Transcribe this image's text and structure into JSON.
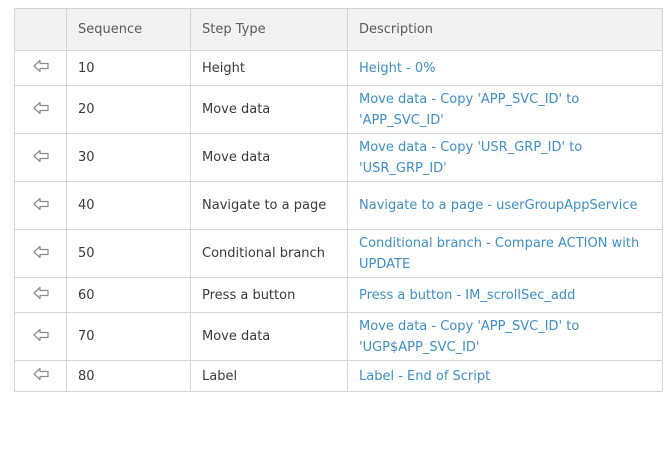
{
  "table": {
    "headers": [
      "",
      "Sequence",
      "Step Type",
      "Description"
    ],
    "rows": [
      {
        "sequence": "10",
        "step_type": "Height",
        "description": "Height - 0%"
      },
      {
        "sequence": "20",
        "step_type": "Move data",
        "description": "Move data - Copy 'APP_SVC_ID' to 'APP_SVC_ID'"
      },
      {
        "sequence": "30",
        "step_type": "Move data",
        "description": "Move data - Copy 'USR_GRP_ID' to 'USR_GRP_ID'"
      },
      {
        "sequence": "40",
        "step_type": "Navigate to a page",
        "description": "Navigate to a page - userGroupAppService"
      },
      {
        "sequence": "50",
        "step_type": "Conditional branch",
        "description": "Conditional branch - Compare ACTION with UPDATE"
      },
      {
        "sequence": "60",
        "step_type": "Press a button",
        "description": "Press a button - IM_scrollSec_add"
      },
      {
        "sequence": "70",
        "step_type": "Move data",
        "description": "Move data - Copy 'APP_SVC_ID' to 'UGP$APP_SVC_ID'"
      },
      {
        "sequence": "80",
        "step_type": "Label",
        "description": "Label - End of Script"
      }
    ]
  },
  "icons": {
    "row_action": "left-arrow-outline-icon"
  },
  "colors": {
    "header_bg": "#f2f2f2",
    "border": "#d4d4d4",
    "link": "#3d8fc6",
    "text": "#3a3a3a"
  }
}
